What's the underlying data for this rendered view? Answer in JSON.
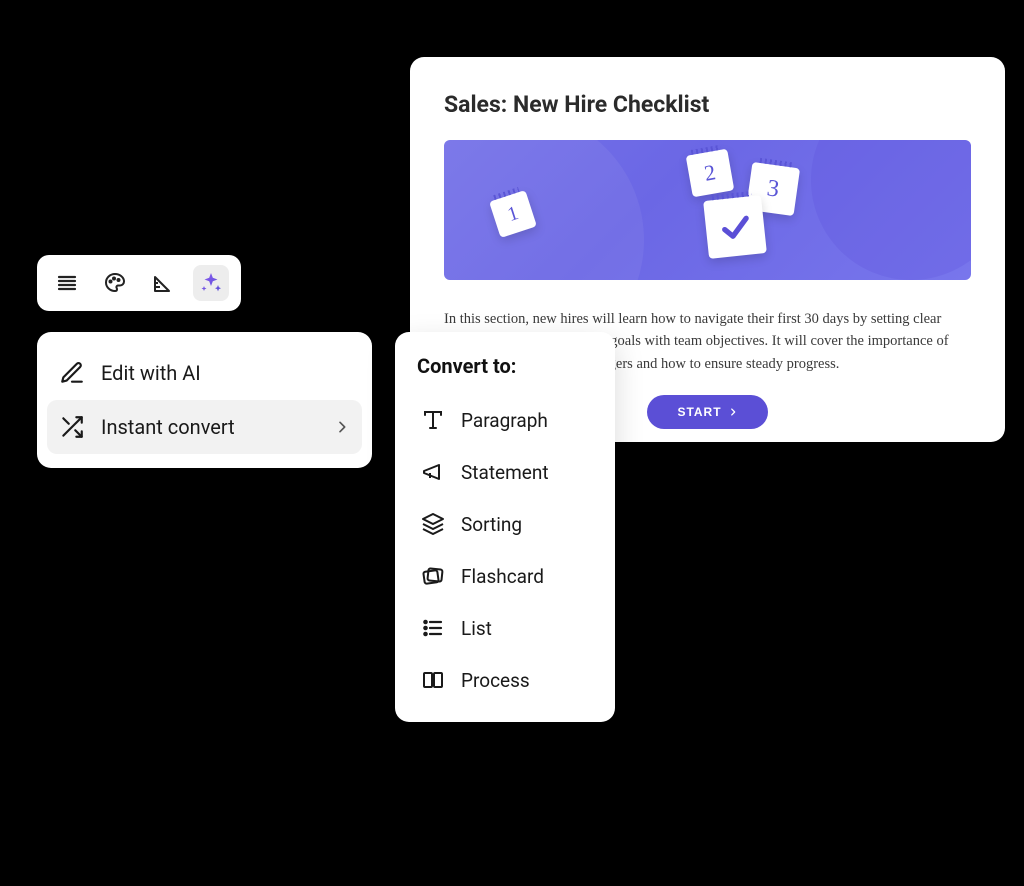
{
  "doc": {
    "title": "Sales: New Hire Checklist",
    "body": "In this section, new hires will learn how to navigate their first 30 days by setting clear weekly tasks that align their goals with team objectives. It will cover the importance of regular check-ins with managers and how to ensure steady progress.",
    "start_label": "START",
    "hero_numbers": [
      "1",
      "2",
      "3"
    ]
  },
  "toolbar": {
    "icons": [
      "align",
      "palette",
      "ruler",
      "ai-sparkle"
    ],
    "active": "ai-sparkle"
  },
  "ai_menu": {
    "items": [
      {
        "icon": "edit",
        "label": "Edit with AI",
        "has_sub": false
      },
      {
        "icon": "shuffle",
        "label": "Instant convert",
        "has_sub": true
      }
    ],
    "hovered": 1
  },
  "convert_panel": {
    "title": "Convert to:",
    "options": [
      {
        "icon": "paragraph",
        "label": "Paragraph"
      },
      {
        "icon": "statement",
        "label": "Statement"
      },
      {
        "icon": "sorting",
        "label": "Sorting"
      },
      {
        "icon": "flashcard",
        "label": "Flashcard"
      },
      {
        "icon": "list",
        "label": "List"
      },
      {
        "icon": "process",
        "label": "Process"
      }
    ]
  },
  "colors": {
    "accent": "#5b4fd6",
    "hero": "#6b67e5"
  }
}
